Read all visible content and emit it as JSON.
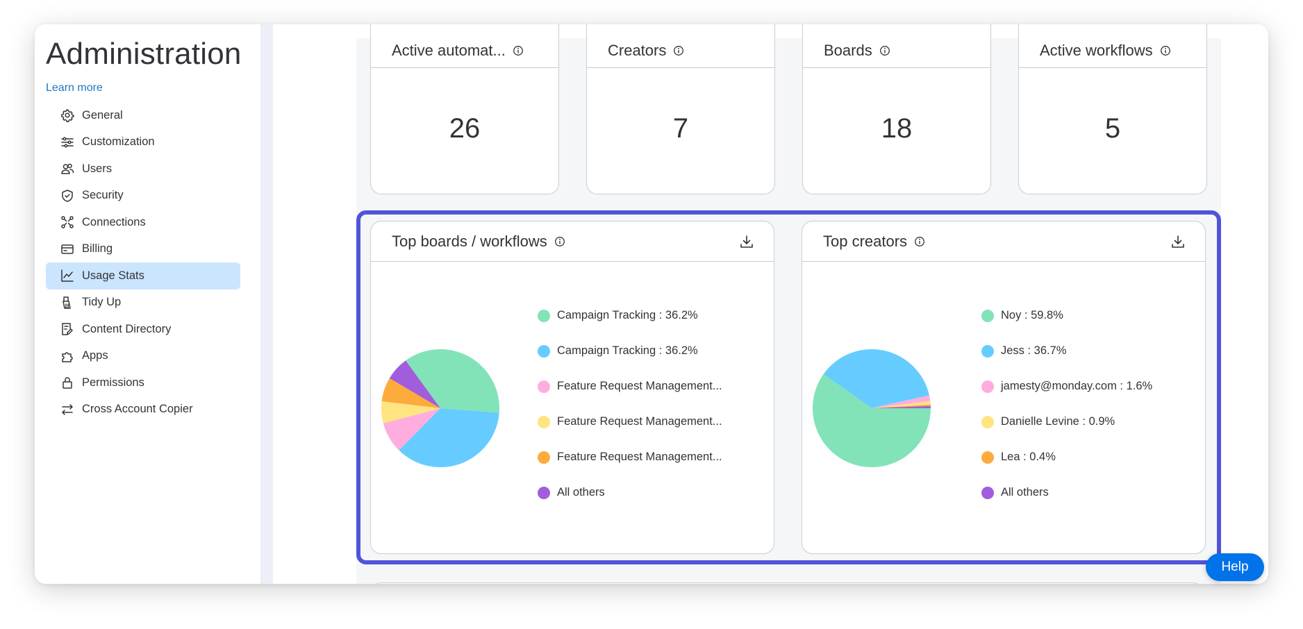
{
  "sidebar": {
    "title": "Administration",
    "learn_more": "Learn more",
    "items": [
      {
        "label": "General",
        "icon": "gear-icon"
      },
      {
        "label": "Customization",
        "icon": "sliders-icon"
      },
      {
        "label": "Users",
        "icon": "users-icon"
      },
      {
        "label": "Security",
        "icon": "shield-icon"
      },
      {
        "label": "Connections",
        "icon": "connections-icon"
      },
      {
        "label": "Billing",
        "icon": "credit-card-icon"
      },
      {
        "label": "Usage Stats",
        "icon": "chart-line-icon",
        "active": true
      },
      {
        "label": "Tidy Up",
        "icon": "broom-icon"
      },
      {
        "label": "Content Directory",
        "icon": "directory-icon"
      },
      {
        "label": "Apps",
        "icon": "puzzle-icon"
      },
      {
        "label": "Permissions",
        "icon": "lock-icon"
      },
      {
        "label": "Cross Account Copier",
        "icon": "swap-arrows-icon"
      }
    ]
  },
  "stats": [
    {
      "title": "Active automat...",
      "value": "26"
    },
    {
      "title": "Creators",
      "value": "7"
    },
    {
      "title": "Boards",
      "value": "18"
    },
    {
      "title": "Active workflows",
      "value": "5"
    }
  ],
  "top_boards": {
    "title": "Top boards / workflows",
    "legend": [
      "Campaign Tracking : 36.2%",
      "Campaign Tracking : 36.2%",
      "Feature Request Management...",
      "Feature Request Management...",
      "Feature Request Management...",
      "All others"
    ]
  },
  "top_creators": {
    "title": "Top creators",
    "legend": [
      "Noy : 59.8%",
      "Jess : 36.7%",
      "jamesty@monday.com : 1.6%",
      "Danielle Levine : 0.9%",
      "Lea : 0.4%",
      "All others"
    ]
  },
  "help_label": "Help",
  "colors": {
    "slice_1": "#82e3b8",
    "slice_2": "#66ccff",
    "slice_3": "#ffadde",
    "slice_4": "#ffe580",
    "slice_5": "#fdab3d",
    "slice_6": "#a25ddc",
    "accent": "#0073ea",
    "highlight": "#5154d9"
  },
  "chart_data": [
    {
      "type": "pie",
      "title": "Top boards / workflows",
      "categories": [
        "Campaign Tracking",
        "Campaign Tracking",
        "Feature Request Management...",
        "Feature Request Management...",
        "Feature Request Management...",
        "All others"
      ],
      "values": [
        36.2,
        36.2,
        8.5,
        6.0,
        6.6,
        6.5
      ]
    },
    {
      "type": "pie",
      "title": "Top creators",
      "categories": [
        "Noy",
        "Jess",
        "jamesty@monday.com",
        "Danielle Levine",
        "Lea",
        "All others"
      ],
      "values": [
        59.8,
        36.7,
        1.6,
        0.9,
        0.4,
        0.6
      ]
    }
  ]
}
